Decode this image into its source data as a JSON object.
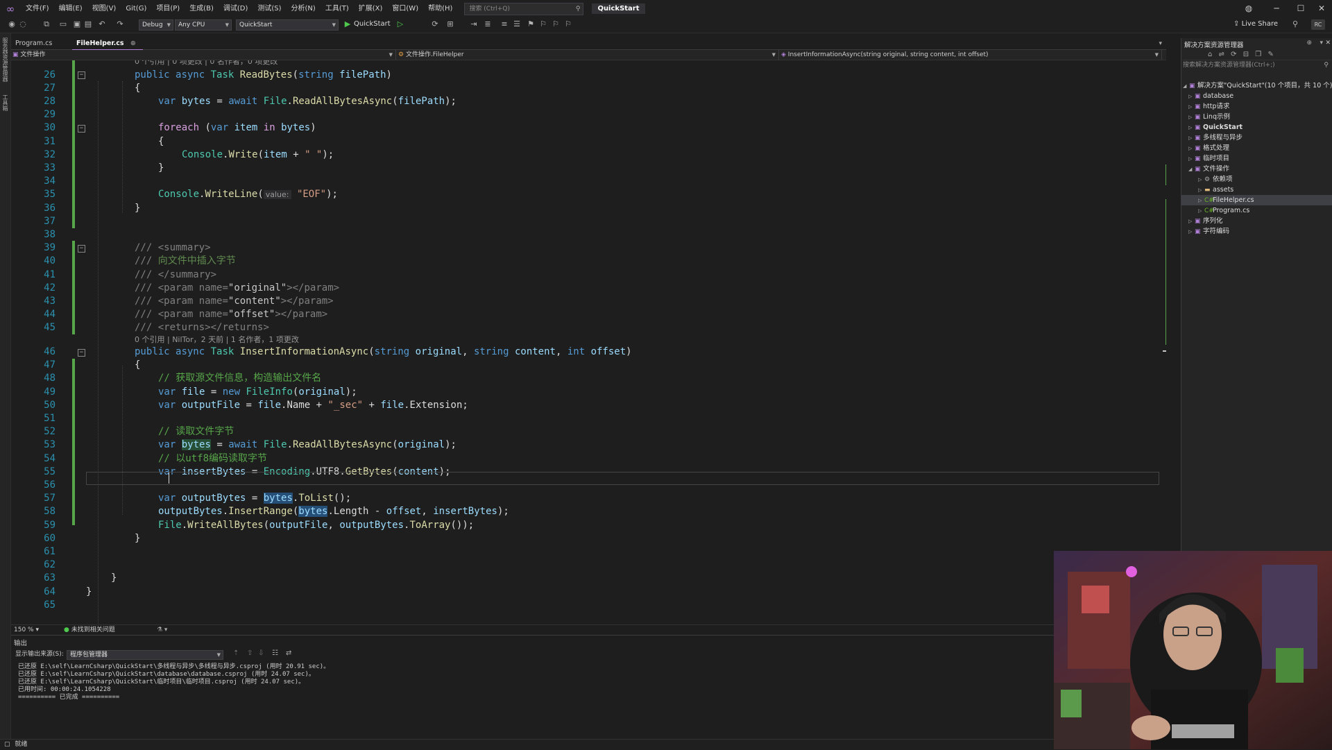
{
  "menu": {
    "items": [
      "文件(F)",
      "编辑(E)",
      "视图(V)",
      "Git(G)",
      "项目(P)",
      "生成(B)",
      "调试(D)",
      "测试(S)",
      "分析(N)",
      "工具(T)",
      "扩展(X)",
      "窗口(W)",
      "帮助(H)"
    ],
    "search_placeholder": "搜索 (Ctrl+Q)",
    "solution_name": "QuickStart"
  },
  "toolbar": {
    "config": "Debug",
    "platform": "Any CPU",
    "startup_project": "QuickStart",
    "run_label": "QuickStart",
    "live_share": "Live Share",
    "account_initials": "RC"
  },
  "left_strip": {
    "tabs": [
      "服务器资源管理器",
      "工具箱"
    ]
  },
  "tabs": [
    {
      "label": "Program.cs",
      "active": false
    },
    {
      "label": "FileHelper.cs",
      "active": true
    }
  ],
  "nav_bar": {
    "project": "文件操作",
    "class": "文件操作.FileHelper",
    "member": "InsertInformationAsync(string original, string content, int offset)"
  },
  "editor": {
    "codelens_top": "0 个引用 | 0 项更改 | 0 名作者，0 项更改",
    "codelens_46": "0 个引用 | NilTor，2 天前 | 1 名作者，1 项更改",
    "line_numbers": [
      "26",
      "27",
      "28",
      "29",
      "30",
      "31",
      "32",
      "33",
      "34",
      "35",
      "36",
      "37",
      "38",
      "39",
      "40",
      "41",
      "42",
      "43",
      "44",
      "45",
      "46",
      "47",
      "48",
      "49",
      "50",
      "51",
      "52",
      "53",
      "54",
      "55",
      "56",
      "57",
      "58",
      "59",
      "60",
      "61",
      "62",
      "63",
      "64",
      "65"
    ],
    "param_hint": "value:",
    "zoom": "150 %",
    "issues": "未找到相关问题"
  },
  "code_tokens": {
    "kw_public": "public",
    "kw_async": "async",
    "kw_var": "var",
    "kw_await": "await",
    "kw_foreach": "foreach",
    "kw_in": "in",
    "kw_string": "string",
    "kw_int": "int",
    "kw_new": "new",
    "t_Task": "Task",
    "t_File": "File",
    "t_Console": "Console",
    "t_FileInfo": "FileInfo",
    "t_Encoding": "Encoding",
    "m_ReadBytes": "ReadBytes",
    "m_ReadAllBytesAsync": "ReadAllBytesAsync",
    "m_Write": "Write",
    "m_WriteLine": "WriteLine",
    "m_InsertInformationAsync": "InsertInformationAsync",
    "m_GetBytes": "GetBytes",
    "m_ToList": "ToList",
    "m_InsertRange": "InsertRange",
    "m_WriteAllBytes": "WriteAllBytes",
    "m_ToArray": "ToArray",
    "v_filePath": "filePath",
    "v_bytes": "bytes",
    "v_item": "item",
    "v_original": "original",
    "v_content": "content",
    "v_offset": "offset",
    "v_file": "file",
    "v_outputFile": "outputFile",
    "v_insertBytes": "insertBytes",
    "v_outputBytes": "outputBytes",
    "p_Name": "Name",
    "p_Extension": "Extension",
    "p_UTF8": "UTF8",
    "p_Length": "Length",
    "s_space": "\" \"",
    "s_EOF": "\"EOF\"",
    "s_sec": "\"_sec\"",
    "s_original": "\"original\"",
    "s_content": "\"content\"",
    "s_offset": "\"offset\"",
    "doc_slash": "///",
    "doc_summary_open": "<summary>",
    "doc_summary_text": "向文件中插入字节",
    "doc_summary_close": "</summary>",
    "doc_param": "<param name=",
    "doc_param_close": "></param>",
    "doc_returns": "<returns></returns>",
    "c_48": "// 获取源文件信息，构造输出文件名",
    "c_52": "// 读取文件字节",
    "c_54": "// 以utf8编码读取字节"
  },
  "output": {
    "title": "输出",
    "source_label": "显示输出来源(S):",
    "source_value": "程序包管理器",
    "lines": [
      "已还原 E:\\self\\LearnCsharp\\QuickStart\\多线程与异步\\多线程与异步.csproj (用时 20.91 sec)。",
      "已还原 E:\\self\\LearnCsharp\\QuickStart\\database\\database.csproj (用时 24.07 sec)。",
      "已还原 E:\\self\\LearnCsharp\\QuickStart\\临时项目\\临时项目.csproj (用时 24.07 sec)。",
      "已用时间: 00:00:24.1054228",
      "========== 已完成 =========="
    ]
  },
  "solution_explorer": {
    "title": "解决方案资源管理器",
    "search_placeholder": "搜索解决方案资源管理器(Ctrl+;)",
    "root": "解决方案\"QuickStart\"(10 个项目，共 10 个)",
    "items": [
      {
        "label": "database",
        "level": 1
      },
      {
        "label": "http请求",
        "level": 1
      },
      {
        "label": "Linq示例",
        "level": 1
      },
      {
        "label": "QuickStart",
        "level": 1
      },
      {
        "label": "多线程与异步",
        "level": 1
      },
      {
        "label": "格式处理",
        "level": 1
      },
      {
        "label": "临时项目",
        "level": 1
      },
      {
        "label": "文件操作",
        "level": 1
      },
      {
        "label": "依赖项",
        "level": 2
      },
      {
        "label": "assets",
        "level": 2
      },
      {
        "label": "FileHelper.cs",
        "level": 2
      },
      {
        "label": "Program.cs",
        "level": 2
      },
      {
        "label": "序列化",
        "level": 1
      },
      {
        "label": "字符编码",
        "level": 1
      }
    ]
  },
  "status_bar": {
    "text": "就绪"
  },
  "colors": {
    "accent": "#b180d7",
    "line_number": "#2b91af",
    "comment": "#57a64a",
    "keyword": "#569cd6",
    "string": "#d69d85",
    "type": "#4ec9b0"
  }
}
